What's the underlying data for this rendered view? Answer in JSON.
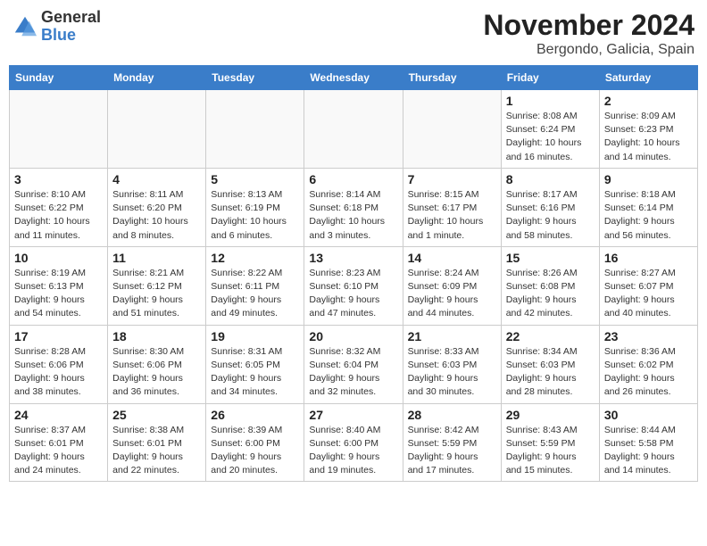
{
  "header": {
    "logo_general": "General",
    "logo_blue": "Blue",
    "month_title": "November 2024",
    "location": "Bergondo, Galicia, Spain"
  },
  "days_of_week": [
    "Sunday",
    "Monday",
    "Tuesday",
    "Wednesday",
    "Thursday",
    "Friday",
    "Saturday"
  ],
  "weeks": [
    [
      {
        "day": "",
        "info": ""
      },
      {
        "day": "",
        "info": ""
      },
      {
        "day": "",
        "info": ""
      },
      {
        "day": "",
        "info": ""
      },
      {
        "day": "",
        "info": ""
      },
      {
        "day": "1",
        "info": "Sunrise: 8:08 AM\nSunset: 6:24 PM\nDaylight: 10 hours and 16 minutes."
      },
      {
        "day": "2",
        "info": "Sunrise: 8:09 AM\nSunset: 6:23 PM\nDaylight: 10 hours and 14 minutes."
      }
    ],
    [
      {
        "day": "3",
        "info": "Sunrise: 8:10 AM\nSunset: 6:22 PM\nDaylight: 10 hours and 11 minutes."
      },
      {
        "day": "4",
        "info": "Sunrise: 8:11 AM\nSunset: 6:20 PM\nDaylight: 10 hours and 8 minutes."
      },
      {
        "day": "5",
        "info": "Sunrise: 8:13 AM\nSunset: 6:19 PM\nDaylight: 10 hours and 6 minutes."
      },
      {
        "day": "6",
        "info": "Sunrise: 8:14 AM\nSunset: 6:18 PM\nDaylight: 10 hours and 3 minutes."
      },
      {
        "day": "7",
        "info": "Sunrise: 8:15 AM\nSunset: 6:17 PM\nDaylight: 10 hours and 1 minute."
      },
      {
        "day": "8",
        "info": "Sunrise: 8:17 AM\nSunset: 6:16 PM\nDaylight: 9 hours and 58 minutes."
      },
      {
        "day": "9",
        "info": "Sunrise: 8:18 AM\nSunset: 6:14 PM\nDaylight: 9 hours and 56 minutes."
      }
    ],
    [
      {
        "day": "10",
        "info": "Sunrise: 8:19 AM\nSunset: 6:13 PM\nDaylight: 9 hours and 54 minutes."
      },
      {
        "day": "11",
        "info": "Sunrise: 8:21 AM\nSunset: 6:12 PM\nDaylight: 9 hours and 51 minutes."
      },
      {
        "day": "12",
        "info": "Sunrise: 8:22 AM\nSunset: 6:11 PM\nDaylight: 9 hours and 49 minutes."
      },
      {
        "day": "13",
        "info": "Sunrise: 8:23 AM\nSunset: 6:10 PM\nDaylight: 9 hours and 47 minutes."
      },
      {
        "day": "14",
        "info": "Sunrise: 8:24 AM\nSunset: 6:09 PM\nDaylight: 9 hours and 44 minutes."
      },
      {
        "day": "15",
        "info": "Sunrise: 8:26 AM\nSunset: 6:08 PM\nDaylight: 9 hours and 42 minutes."
      },
      {
        "day": "16",
        "info": "Sunrise: 8:27 AM\nSunset: 6:07 PM\nDaylight: 9 hours and 40 minutes."
      }
    ],
    [
      {
        "day": "17",
        "info": "Sunrise: 8:28 AM\nSunset: 6:06 PM\nDaylight: 9 hours and 38 minutes."
      },
      {
        "day": "18",
        "info": "Sunrise: 8:30 AM\nSunset: 6:06 PM\nDaylight: 9 hours and 36 minutes."
      },
      {
        "day": "19",
        "info": "Sunrise: 8:31 AM\nSunset: 6:05 PM\nDaylight: 9 hours and 34 minutes."
      },
      {
        "day": "20",
        "info": "Sunrise: 8:32 AM\nSunset: 6:04 PM\nDaylight: 9 hours and 32 minutes."
      },
      {
        "day": "21",
        "info": "Sunrise: 8:33 AM\nSunset: 6:03 PM\nDaylight: 9 hours and 30 minutes."
      },
      {
        "day": "22",
        "info": "Sunrise: 8:34 AM\nSunset: 6:03 PM\nDaylight: 9 hours and 28 minutes."
      },
      {
        "day": "23",
        "info": "Sunrise: 8:36 AM\nSunset: 6:02 PM\nDaylight: 9 hours and 26 minutes."
      }
    ],
    [
      {
        "day": "24",
        "info": "Sunrise: 8:37 AM\nSunset: 6:01 PM\nDaylight: 9 hours and 24 minutes."
      },
      {
        "day": "25",
        "info": "Sunrise: 8:38 AM\nSunset: 6:01 PM\nDaylight: 9 hours and 22 minutes."
      },
      {
        "day": "26",
        "info": "Sunrise: 8:39 AM\nSunset: 6:00 PM\nDaylight: 9 hours and 20 minutes."
      },
      {
        "day": "27",
        "info": "Sunrise: 8:40 AM\nSunset: 6:00 PM\nDaylight: 9 hours and 19 minutes."
      },
      {
        "day": "28",
        "info": "Sunrise: 8:42 AM\nSunset: 5:59 PM\nDaylight: 9 hours and 17 minutes."
      },
      {
        "day": "29",
        "info": "Sunrise: 8:43 AM\nSunset: 5:59 PM\nDaylight: 9 hours and 15 minutes."
      },
      {
        "day": "30",
        "info": "Sunrise: 8:44 AM\nSunset: 5:58 PM\nDaylight: 9 hours and 14 minutes."
      }
    ]
  ]
}
